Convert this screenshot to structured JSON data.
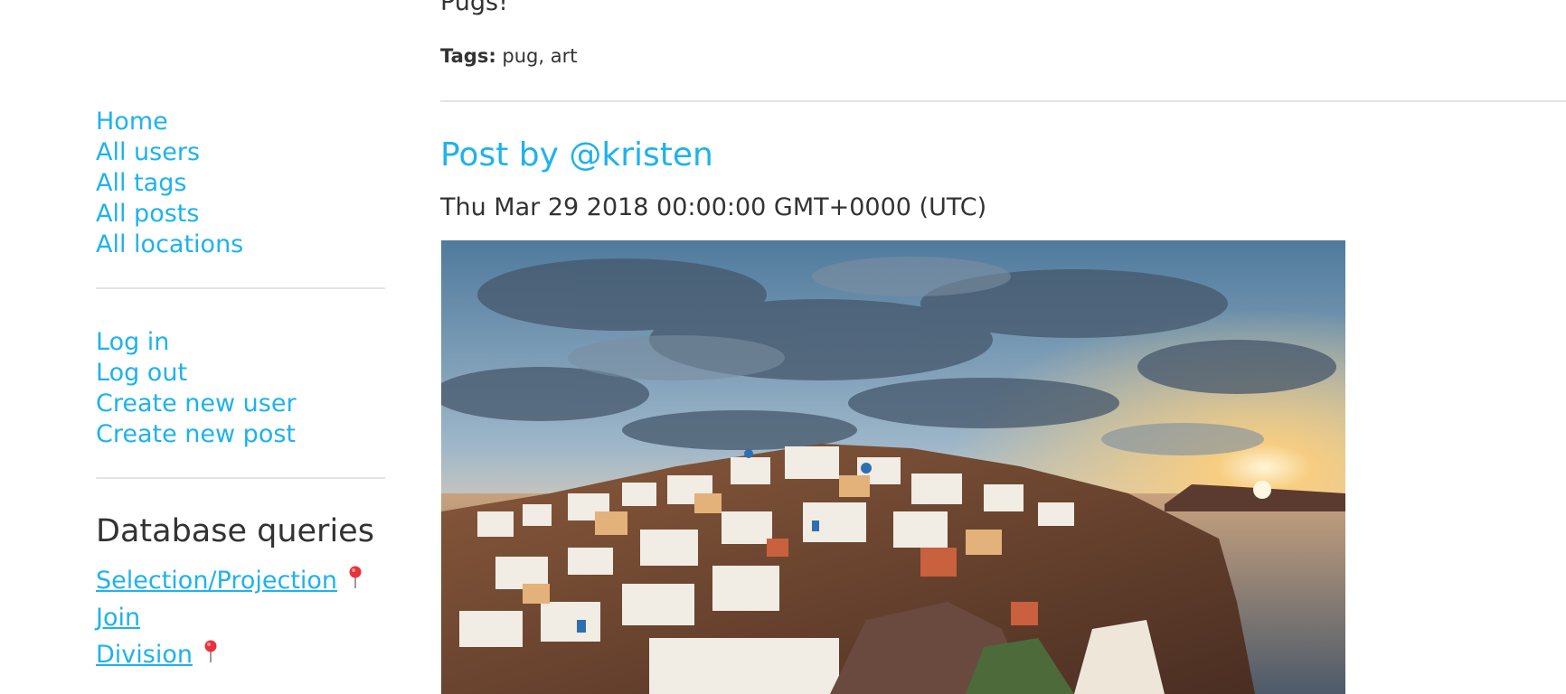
{
  "sidebar": {
    "nav": [
      {
        "label": "Home"
      },
      {
        "label": "All users"
      },
      {
        "label": "All tags"
      },
      {
        "label": "All posts"
      },
      {
        "label": "All locations"
      }
    ],
    "account": [
      {
        "label": "Log in"
      },
      {
        "label": "Log out"
      },
      {
        "label": "Create new user"
      },
      {
        "label": "Create new post"
      }
    ],
    "queries_heading": "Database queries",
    "queries": [
      {
        "label": "Selection/Projection",
        "icon": "pin-icon"
      },
      {
        "label": "Join"
      },
      {
        "label": "Division",
        "icon": "pin-icon"
      }
    ]
  },
  "previous_post": {
    "body": "Pugs!",
    "tags_label": "Tags:",
    "tags_value": "pug, art"
  },
  "post": {
    "title": "Post by @kristen",
    "date": "Thu Mar 29 2018 00:00:00 GMT+0000 (UTC)",
    "image_description": "santorini-sunset-photo"
  },
  "colors": {
    "link": "#1fb2ec",
    "text": "#333333",
    "rule": "#e4e4e4",
    "pin": "#e8323c"
  }
}
